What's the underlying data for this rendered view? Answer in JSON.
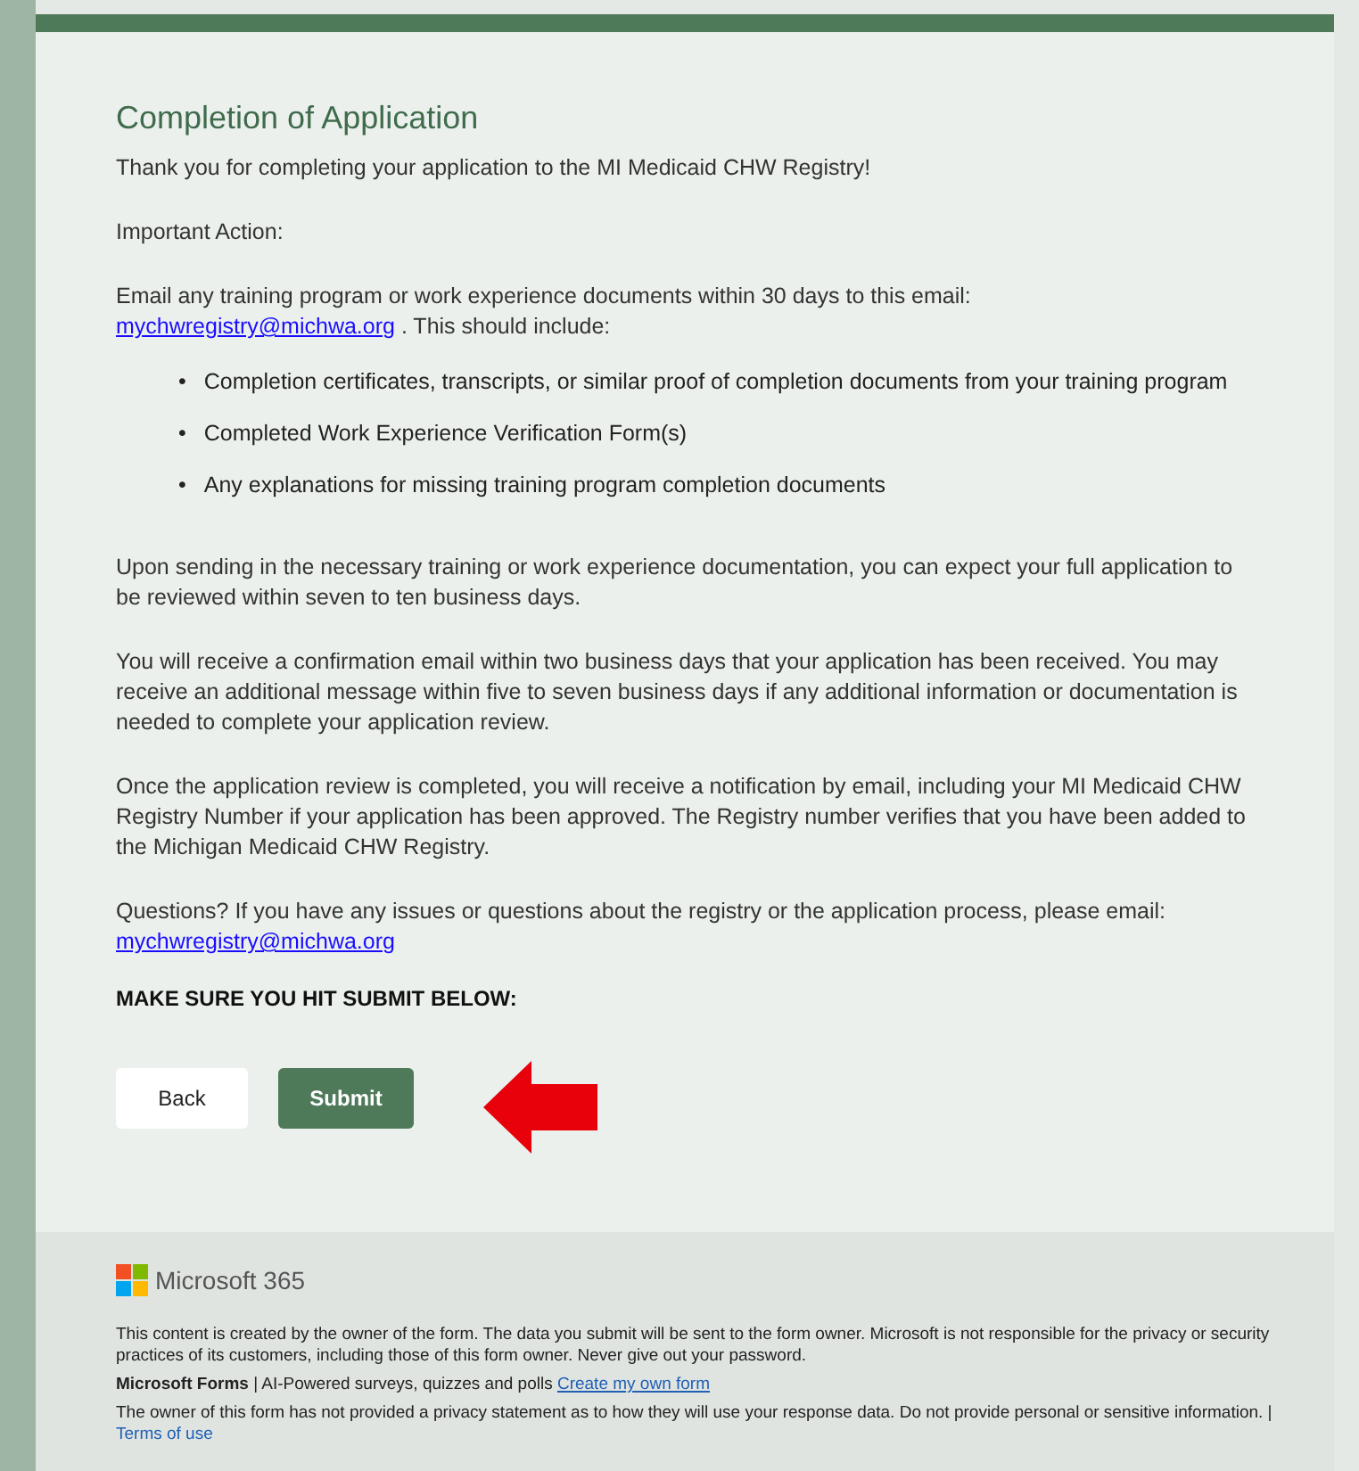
{
  "title": "Completion of Application",
  "paragraphs": [
    {
      "text": "Thank you for completing your application to the MI Medicaid CHW Registry!"
    },
    {
      "text": "Important Action:"
    },
    {
      "text": " Email any training program or work experience documents within 30 days to this email: ",
      "link": "mychwregistry@michwa.org",
      "after": " . This should include:"
    }
  ],
  "bullets": [
    {
      "marker": "•",
      "text": "Completion certificates, transcripts, or similar proof of completion documents from your training program"
    },
    {
      "marker": "•",
      "text": "Completed Work Experience Verification Form(s)"
    },
    {
      "marker": "•",
      "text": "Any explanations for missing training program completion documents"
    }
  ],
  "paragraphs_2": [
    {
      "text": "Upon sending in the necessary training or work experience documentation, you can expect your full application to be reviewed within seven to ten business days."
    },
    {
      "text": "You will receive a confirmation email within two business days that your application has been received.  You may receive an additional message within five to seven business days if any additional information or documentation is needed to complete your application review."
    },
    {
      "text": "Once the application review is completed, you will receive a notification by email, including your MI Medicaid CHW Registry Number if your application has been approved.  The Registry number verifies that you have been added to the Michigan Medicaid CHW Registry."
    },
    {
      "text": "Questions?  If you have any issues or questions about the registry or the application process, please email:   ",
      "link": "mychwregistry@michwa.org"
    }
  ],
  "notice": "MAKE SURE YOU HIT SUBMIT BELOW:",
  "buttons": [
    {
      "label": "Back",
      "kind": "secondary"
    },
    {
      "label": "Submit",
      "kind": "primary"
    }
  ],
  "footer": {
    "brand": "Microsoft 365",
    "disclaimer": "This content is created by the owner of the form. The data you submit will be sent to the form owner. Microsoft is not responsible for the privacy or security practices of its customers, including those of this form owner. Never give out your password.",
    "forms_line": "**Microsoft Forms** | AI-Powered surveys, quizzes and polls",
    "forms_link": "Create my own form",
    "privacy": "The owner of this form has not provided a privacy statement as to how they will use your response data. Do not provide personal or sensitive information. | ",
    "privacy_link": "Terms of use"
  }
}
